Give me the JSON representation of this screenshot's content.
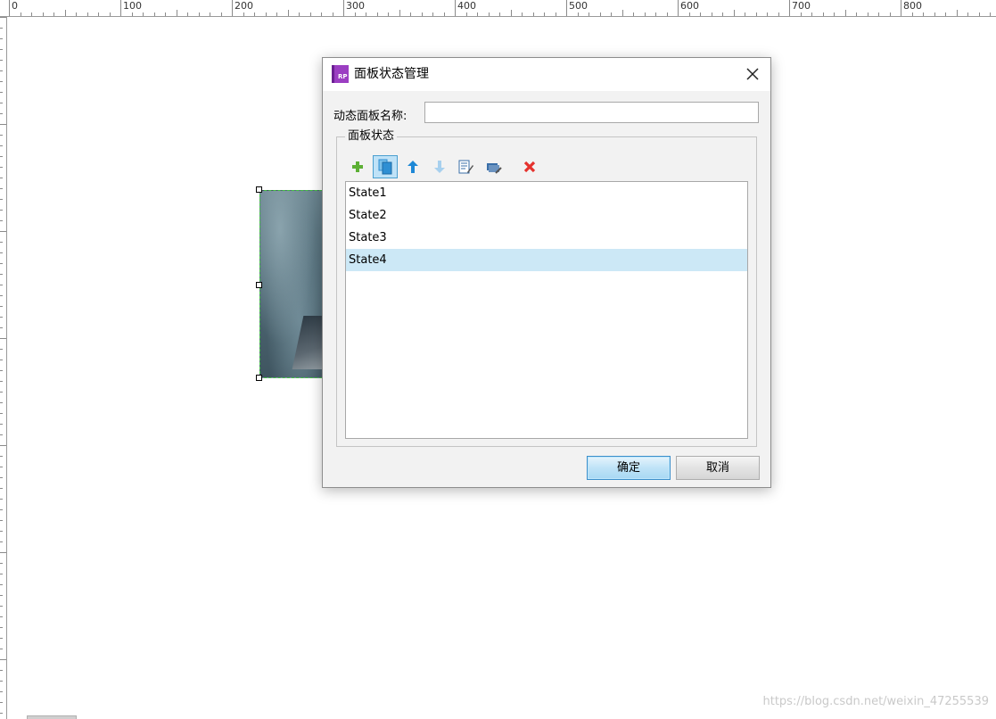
{
  "ruler": {
    "labels": [
      "0",
      "100",
      "200",
      "300",
      "400",
      "500",
      "600",
      "700",
      "800"
    ]
  },
  "dialog": {
    "title": "面板状态管理",
    "logo_text": "RP",
    "logo_icon": "axure-rp-icon",
    "close_icon": "close-icon",
    "name_label": "动态面板名称:",
    "name_value": "",
    "group_title": "面板状态",
    "toolbar": [
      {
        "name": "add-state",
        "icon": "plus-icon",
        "color": "#5db035"
      },
      {
        "name": "duplicate-state",
        "icon": "copy-icon",
        "color": "#2f8fd3",
        "active": true
      },
      {
        "name": "move-up",
        "icon": "arrow-up-icon",
        "color": "#1e88d6"
      },
      {
        "name": "move-down",
        "icon": "arrow-down-icon",
        "color": "#a7d0ee"
      },
      {
        "name": "edit-state",
        "icon": "edit-icon",
        "color": "#3a6fa8"
      },
      {
        "name": "edit-all-states",
        "icon": "edit-all-icon",
        "color": "#3a6fa8"
      },
      {
        "name": "delete-state",
        "icon": "delete-icon",
        "color": "#e5322d"
      }
    ],
    "states": [
      "State1",
      "State2",
      "State3",
      "State4"
    ],
    "selected_state": "State4",
    "ok_label": "确定",
    "cancel_label": "取消"
  },
  "watermark": "https://blog.csdn.net/weixin_47255539"
}
